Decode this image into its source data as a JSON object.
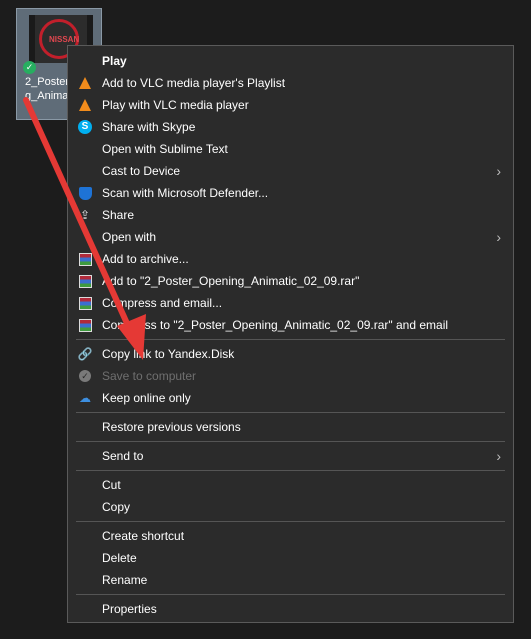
{
  "desktop": {
    "file_name": "2_Poster_\ng_Anima",
    "thumb_brand": "NISSAN"
  },
  "menu": {
    "items": [
      {
        "label": "Play",
        "icon": "none",
        "bold": true
      },
      {
        "label": "Add to VLC media player's Playlist",
        "icon": "vlc-icon"
      },
      {
        "label": "Play with VLC media player",
        "icon": "vlc-icon"
      },
      {
        "label": "Share with Skype",
        "icon": "skype-icon"
      },
      {
        "label": "Open with Sublime Text",
        "icon": "none"
      },
      {
        "label": "Cast to Device",
        "icon": "none",
        "submenu": true
      },
      {
        "label": "Scan with Microsoft Defender...",
        "icon": "defender-icon"
      },
      {
        "label": "Share",
        "icon": "share-icon"
      },
      {
        "label": "Open with",
        "icon": "none",
        "submenu": true
      },
      {
        "label": "Add to archive...",
        "icon": "winrar-icon"
      },
      {
        "label": "Add to \"2_Poster_Opening_Animatic_02_09.rar\"",
        "icon": "winrar-icon"
      },
      {
        "label": "Compress and email...",
        "icon": "winrar-icon"
      },
      {
        "label": "Compress to \"2_Poster_Opening_Animatic_02_09.rar\" and email",
        "icon": "winrar-icon"
      },
      {
        "label": "Copy link to Yandex.Disk",
        "icon": "link-icon"
      },
      {
        "label": "Save to computer",
        "icon": "check-circle-icon",
        "disabled": true
      },
      {
        "label": "Keep online only",
        "icon": "cloud-icon"
      },
      {
        "label": "Restore previous versions",
        "icon": "none"
      },
      {
        "label": "Send to",
        "icon": "none",
        "submenu": true
      },
      {
        "label": "Cut",
        "icon": "none"
      },
      {
        "label": "Copy",
        "icon": "none"
      },
      {
        "label": "Create shortcut",
        "icon": "none"
      },
      {
        "label": "Delete",
        "icon": "none"
      },
      {
        "label": "Rename",
        "icon": "none"
      },
      {
        "label": "Properties",
        "icon": "none"
      }
    ]
  },
  "colors": {
    "menu_bg": "#2b2b2b",
    "arrow": "#e53935",
    "text": "#ffffff",
    "disabled_text": "#6f6f6f"
  }
}
